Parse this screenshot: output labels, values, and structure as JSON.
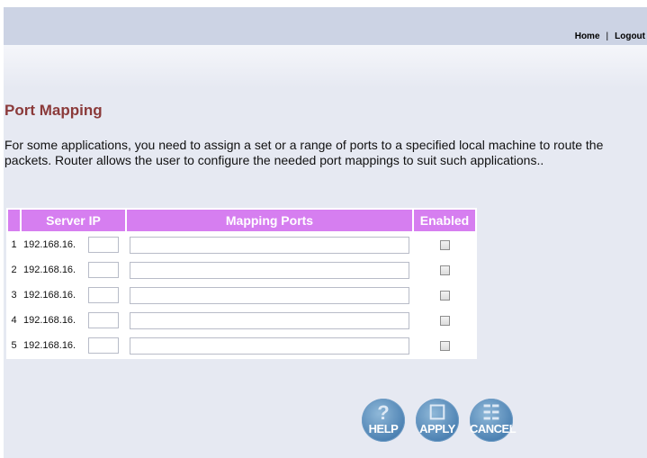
{
  "top_links": {
    "home": "Home",
    "separator": "|",
    "logout": "Logout"
  },
  "page": {
    "title": "Port Mapping",
    "description": "For some applications, you need to assign a set or a range of ports to a specified local machine to route the packets. Router allows the user to configure the needed port mappings to suit such applications.."
  },
  "table": {
    "headers": {
      "server_ip": "Server IP",
      "mapping_ports": "Mapping Ports",
      "enabled": "Enabled"
    },
    "rows": [
      {
        "num": "1",
        "ip_prefix": "192.168.16.",
        "ip_suffix": "",
        "ports": "",
        "enabled": false
      },
      {
        "num": "2",
        "ip_prefix": "192.168.16.",
        "ip_suffix": "",
        "ports": "",
        "enabled": false
      },
      {
        "num": "3",
        "ip_prefix": "192.168.16.",
        "ip_suffix": "",
        "ports": "",
        "enabled": false
      },
      {
        "num": "4",
        "ip_prefix": "192.168.16.",
        "ip_suffix": "",
        "ports": "",
        "enabled": false
      },
      {
        "num": "5",
        "ip_prefix": "192.168.16.",
        "ip_suffix": "",
        "ports": "",
        "enabled": false
      }
    ]
  },
  "buttons": {
    "help": "HELP",
    "apply": "APPLY",
    "cancel": "CANCEL"
  },
  "icons": {
    "help": "question-icon",
    "apply": "apply-icon",
    "cancel": "trash-icon"
  },
  "colors": {
    "header_bg": "#d67ef0",
    "title": "#8b3a3a",
    "button": "#4d82b3",
    "topbar": "#ccd3e4",
    "page_bg": "#e6e9f2"
  }
}
